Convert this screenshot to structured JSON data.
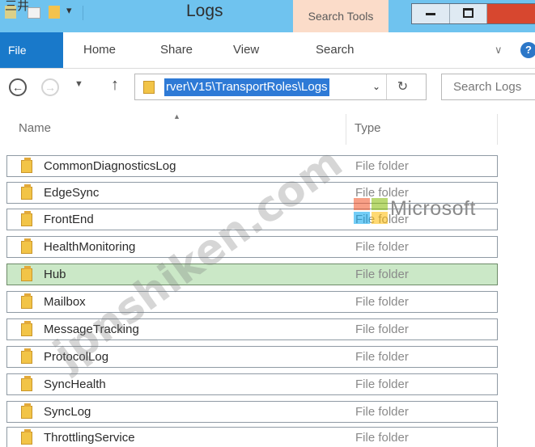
{
  "corner_text": "三井",
  "window": {
    "title": "Logs",
    "context_tab": "Search Tools"
  },
  "ribbon": {
    "tabs": [
      "File",
      "Home",
      "Share",
      "View",
      "Search"
    ]
  },
  "address": {
    "path": "rver\\V15\\TransportRoles\\Logs",
    "search_placeholder": "Search Logs"
  },
  "columns": {
    "name": "Name",
    "type": "Type"
  },
  "files": [
    {
      "name": "CommonDiagnosticsLog",
      "type": "File folder"
    },
    {
      "name": "EdgeSync",
      "type": "File folder"
    },
    {
      "name": "FrontEnd",
      "type": "File folder"
    },
    {
      "name": "HealthMonitoring",
      "type": "File folder"
    },
    {
      "name": "Hub",
      "type": "File folder",
      "selected": true
    },
    {
      "name": "Mailbox",
      "type": "File folder"
    },
    {
      "name": "MessageTracking",
      "type": "File folder"
    },
    {
      "name": "ProtocolLog",
      "type": "File folder"
    },
    {
      "name": "SyncHealth",
      "type": "File folder"
    },
    {
      "name": "SyncLog",
      "type": "File folder"
    },
    {
      "name": "ThrottlingService",
      "type": "File folder"
    }
  ],
  "overlays": {
    "brand_text": "Microsoft",
    "watermark": "jpnshiken.com"
  },
  "colors": {
    "titlebar": "#6fc3ef",
    "file_tab": "#1979ca",
    "search_tools": "#fbdcc9",
    "close_button": "#d7472f",
    "selection": "#cbe8c7",
    "address_highlight": "#2e7ad6"
  },
  "icons": {
    "back": "back-icon",
    "forward": "forward-icon",
    "up": "up-arrow-icon",
    "refresh": "refresh-icon",
    "folder": "folder-icon",
    "help": "help-icon"
  }
}
